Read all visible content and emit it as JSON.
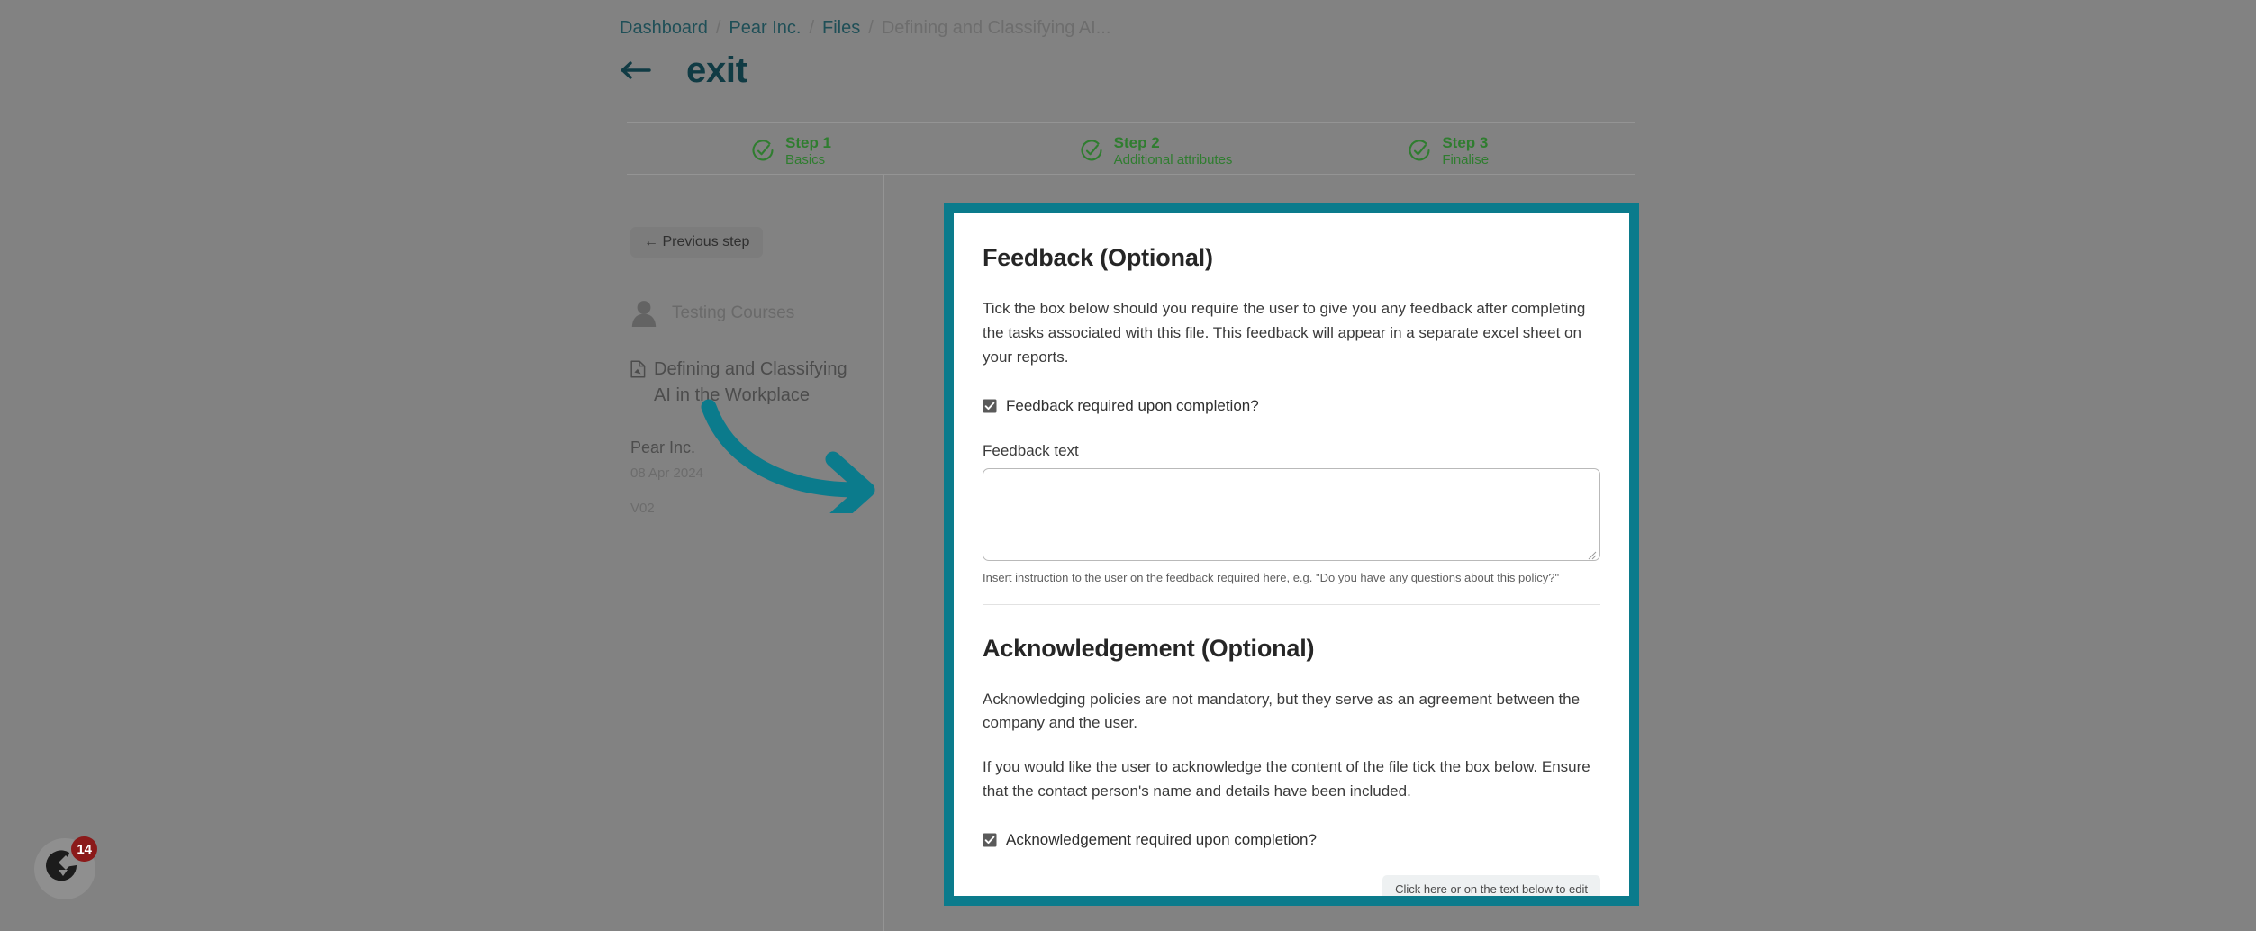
{
  "breadcrumb": {
    "items": [
      {
        "label": "Dashboard",
        "current": false
      },
      {
        "label": "Pear Inc.",
        "current": false
      },
      {
        "label": "Files",
        "current": false
      },
      {
        "label": "Defining and Classifying AI...",
        "current": true
      }
    ],
    "separator": "/"
  },
  "header": {
    "back_icon": "back-arrow-icon",
    "title": "exit"
  },
  "steps": [
    {
      "name": "Step 1",
      "sub": "Basics",
      "icon": "check-circle-icon",
      "state": "complete"
    },
    {
      "name": "Step 2",
      "sub": "Additional attributes",
      "icon": "check-circle-icon",
      "state": "complete"
    },
    {
      "name": "Step 3",
      "sub": "Finalise",
      "icon": "check-circle-icon",
      "state": "complete"
    }
  ],
  "sidebar": {
    "previous_step_label": "← Previous step",
    "org_icon": "user-avatar-icon",
    "org_name": "Testing Courses",
    "file_icon": "file-document-icon",
    "file_title": "Defining and Classifying AI in the Workplace",
    "company": "Pear Inc.",
    "date": "08 Apr 2024",
    "version": "V02"
  },
  "card": {
    "feedback": {
      "heading": "Feedback (Optional)",
      "description": "Tick the box below should you require the user to give you any feedback after completing the tasks associated with this file. This feedback will appear in a separate excel sheet on your reports.",
      "checkbox_label": "Feedback required upon completion?",
      "checkbox_checked": true,
      "field_label": "Feedback text",
      "field_value": "",
      "field_placeholder": "",
      "help_text": "Insert instruction to the user on the feedback required here, e.g. \"Do you have any questions about this policy?\""
    },
    "acknowledgement": {
      "heading": "Acknowledgement (Optional)",
      "paragraph_1": "Acknowledging policies are not mandatory, but they serve as an agreement between the company and the user.",
      "paragraph_2": "If you would like the user to acknowledge the content of the file tick the box below. Ensure that the contact person's name and details have been included.",
      "checkbox_label": "Acknowledgement required upon completion?",
      "checkbox_checked": true
    },
    "edit_hint_label": "Click here or on the text below to edit"
  },
  "widget": {
    "icon": "chat-widget-icon",
    "badge_count": "14"
  },
  "colors": {
    "highlight_border": "#0b7b8c",
    "annotation_arrow": "#0b7b8c",
    "breadcrumb_link": "#1f4f57",
    "title": "#103b44",
    "step_complete": "#2f7d2f",
    "badge": "#8b1a1a",
    "page_dim": "#828282"
  }
}
